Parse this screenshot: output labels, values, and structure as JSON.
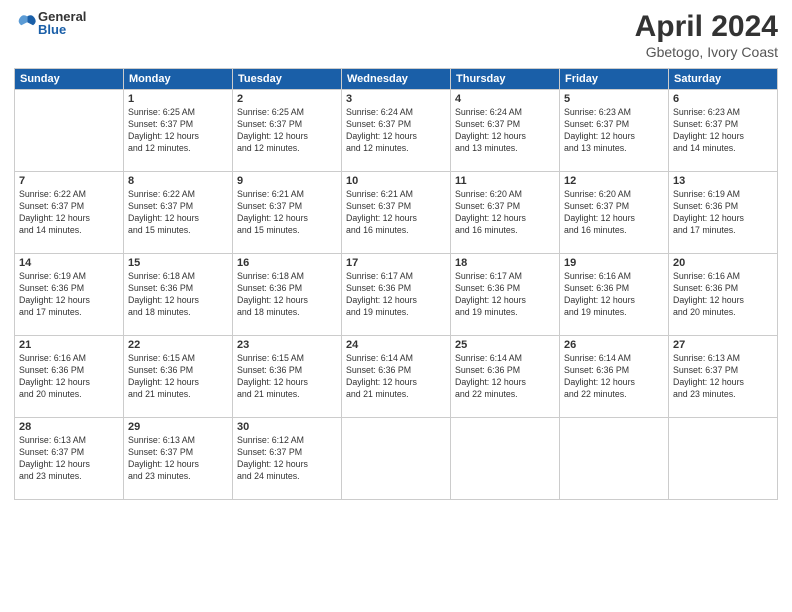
{
  "header": {
    "logo_general": "General",
    "logo_blue": "Blue",
    "title": "April 2024",
    "location": "Gbetogo, Ivory Coast"
  },
  "calendar": {
    "days_of_week": [
      "Sunday",
      "Monday",
      "Tuesday",
      "Wednesday",
      "Thursday",
      "Friday",
      "Saturday"
    ],
    "weeks": [
      [
        {
          "day": "",
          "info": ""
        },
        {
          "day": "1",
          "info": "Sunrise: 6:25 AM\nSunset: 6:37 PM\nDaylight: 12 hours\nand 12 minutes."
        },
        {
          "day": "2",
          "info": "Sunrise: 6:25 AM\nSunset: 6:37 PM\nDaylight: 12 hours\nand 12 minutes."
        },
        {
          "day": "3",
          "info": "Sunrise: 6:24 AM\nSunset: 6:37 PM\nDaylight: 12 hours\nand 12 minutes."
        },
        {
          "day": "4",
          "info": "Sunrise: 6:24 AM\nSunset: 6:37 PM\nDaylight: 12 hours\nand 13 minutes."
        },
        {
          "day": "5",
          "info": "Sunrise: 6:23 AM\nSunset: 6:37 PM\nDaylight: 12 hours\nand 13 minutes."
        },
        {
          "day": "6",
          "info": "Sunrise: 6:23 AM\nSunset: 6:37 PM\nDaylight: 12 hours\nand 14 minutes."
        }
      ],
      [
        {
          "day": "7",
          "info": "Sunrise: 6:22 AM\nSunset: 6:37 PM\nDaylight: 12 hours\nand 14 minutes."
        },
        {
          "day": "8",
          "info": "Sunrise: 6:22 AM\nSunset: 6:37 PM\nDaylight: 12 hours\nand 15 minutes."
        },
        {
          "day": "9",
          "info": "Sunrise: 6:21 AM\nSunset: 6:37 PM\nDaylight: 12 hours\nand 15 minutes."
        },
        {
          "day": "10",
          "info": "Sunrise: 6:21 AM\nSunset: 6:37 PM\nDaylight: 12 hours\nand 16 minutes."
        },
        {
          "day": "11",
          "info": "Sunrise: 6:20 AM\nSunset: 6:37 PM\nDaylight: 12 hours\nand 16 minutes."
        },
        {
          "day": "12",
          "info": "Sunrise: 6:20 AM\nSunset: 6:37 PM\nDaylight: 12 hours\nand 16 minutes."
        },
        {
          "day": "13",
          "info": "Sunrise: 6:19 AM\nSunset: 6:36 PM\nDaylight: 12 hours\nand 17 minutes."
        }
      ],
      [
        {
          "day": "14",
          "info": "Sunrise: 6:19 AM\nSunset: 6:36 PM\nDaylight: 12 hours\nand 17 minutes."
        },
        {
          "day": "15",
          "info": "Sunrise: 6:18 AM\nSunset: 6:36 PM\nDaylight: 12 hours\nand 18 minutes."
        },
        {
          "day": "16",
          "info": "Sunrise: 6:18 AM\nSunset: 6:36 PM\nDaylight: 12 hours\nand 18 minutes."
        },
        {
          "day": "17",
          "info": "Sunrise: 6:17 AM\nSunset: 6:36 PM\nDaylight: 12 hours\nand 19 minutes."
        },
        {
          "day": "18",
          "info": "Sunrise: 6:17 AM\nSunset: 6:36 PM\nDaylight: 12 hours\nand 19 minutes."
        },
        {
          "day": "19",
          "info": "Sunrise: 6:16 AM\nSunset: 6:36 PM\nDaylight: 12 hours\nand 19 minutes."
        },
        {
          "day": "20",
          "info": "Sunrise: 6:16 AM\nSunset: 6:36 PM\nDaylight: 12 hours\nand 20 minutes."
        }
      ],
      [
        {
          "day": "21",
          "info": "Sunrise: 6:16 AM\nSunset: 6:36 PM\nDaylight: 12 hours\nand 20 minutes."
        },
        {
          "day": "22",
          "info": "Sunrise: 6:15 AM\nSunset: 6:36 PM\nDaylight: 12 hours\nand 21 minutes."
        },
        {
          "day": "23",
          "info": "Sunrise: 6:15 AM\nSunset: 6:36 PM\nDaylight: 12 hours\nand 21 minutes."
        },
        {
          "day": "24",
          "info": "Sunrise: 6:14 AM\nSunset: 6:36 PM\nDaylight: 12 hours\nand 21 minutes."
        },
        {
          "day": "25",
          "info": "Sunrise: 6:14 AM\nSunset: 6:36 PM\nDaylight: 12 hours\nand 22 minutes."
        },
        {
          "day": "26",
          "info": "Sunrise: 6:14 AM\nSunset: 6:36 PM\nDaylight: 12 hours\nand 22 minutes."
        },
        {
          "day": "27",
          "info": "Sunrise: 6:13 AM\nSunset: 6:37 PM\nDaylight: 12 hours\nand 23 minutes."
        }
      ],
      [
        {
          "day": "28",
          "info": "Sunrise: 6:13 AM\nSunset: 6:37 PM\nDaylight: 12 hours\nand 23 minutes."
        },
        {
          "day": "29",
          "info": "Sunrise: 6:13 AM\nSunset: 6:37 PM\nDaylight: 12 hours\nand 23 minutes."
        },
        {
          "day": "30",
          "info": "Sunrise: 6:12 AM\nSunset: 6:37 PM\nDaylight: 12 hours\nand 24 minutes."
        },
        {
          "day": "",
          "info": ""
        },
        {
          "day": "",
          "info": ""
        },
        {
          "day": "",
          "info": ""
        },
        {
          "day": "",
          "info": ""
        }
      ]
    ]
  }
}
